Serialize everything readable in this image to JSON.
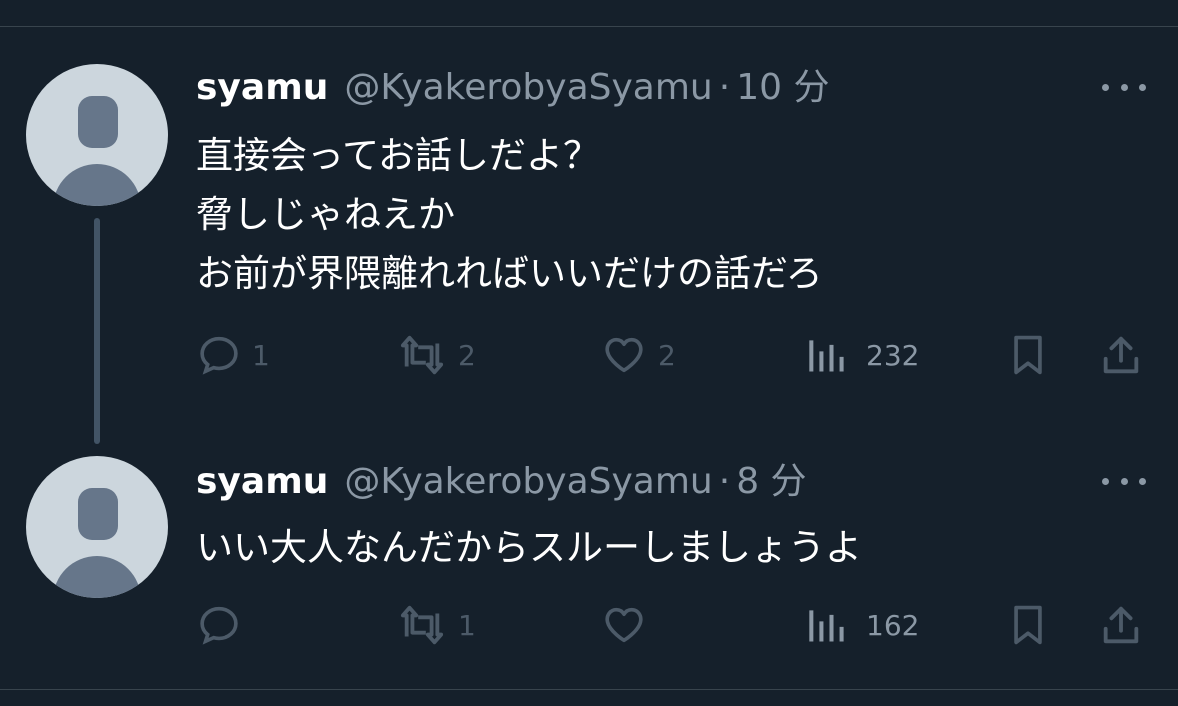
{
  "tweets": [
    {
      "display_name": "syamu",
      "handle": "@KyakerobyaSyamu",
      "separator": "·",
      "time": "10 分",
      "lines": [
        "直接会ってお話しだよ？",
        "脅しじゃねえか",
        "お前が界隈離れればいいだけの話だろ"
      ],
      "reply_count": "1",
      "retweet_count": "2",
      "like_count": "2",
      "view_count": "232"
    },
    {
      "display_name": "syamu",
      "handle": "@KyakerobyaSyamu",
      "separator": "·",
      "time": "8 分",
      "lines": [
        "いい大人なんだからスルーしましょうよ"
      ],
      "reply_count": "",
      "retweet_count": "1",
      "like_count": "",
      "view_count": "162"
    }
  ],
  "icons": {
    "reply": "reply-icon",
    "retweet": "retweet-icon",
    "like": "heart-icon",
    "views": "views-icon",
    "bookmark": "bookmark-icon",
    "share": "share-icon",
    "more": "more-icon"
  },
  "colors": {
    "background": "#15202b",
    "text": "#ffffff",
    "secondary": "#8b98a5",
    "action_dim": "#4c5a68"
  }
}
